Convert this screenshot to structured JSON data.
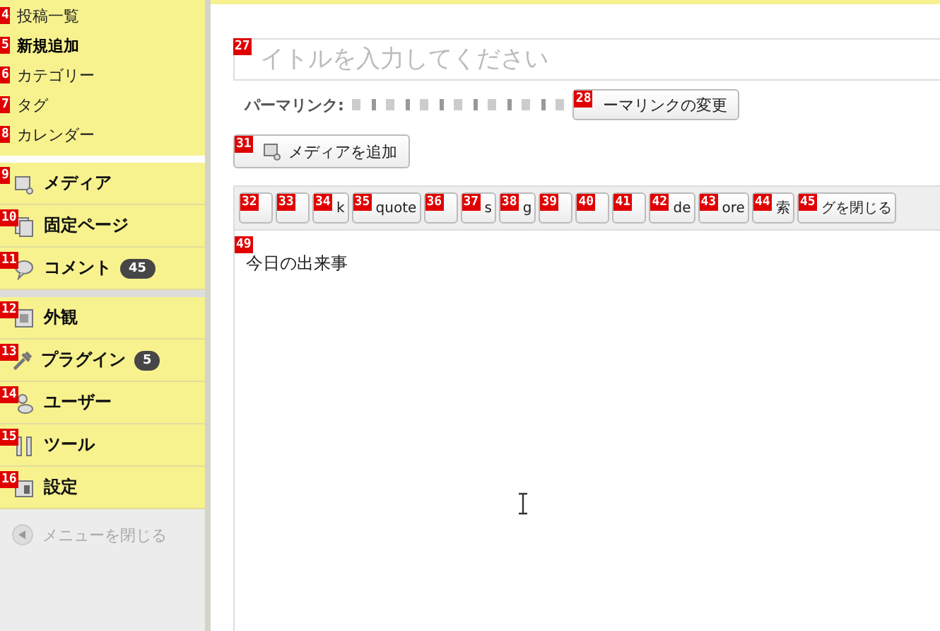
{
  "submenu": [
    {
      "label": "投稿一覧",
      "marker": "4",
      "selected": false
    },
    {
      "label": "新規追加",
      "marker": "5",
      "selected": true
    },
    {
      "label": "カテゴリー",
      "marker": "6",
      "selected": false
    },
    {
      "label": "タグ",
      "marker": "7",
      "selected": false
    },
    {
      "label": "カレンダー",
      "marker": "8",
      "selected": false
    }
  ],
  "menu": [
    {
      "label": "メディア",
      "marker": "9"
    },
    {
      "label": "固定ページ",
      "marker": "10"
    },
    {
      "label": "コメント",
      "marker": "11",
      "count": "45"
    },
    {
      "label": "外観",
      "marker": "12"
    },
    {
      "label": "プラグイン",
      "marker": "13",
      "count": "5"
    },
    {
      "label": "ユーザー",
      "marker": "14"
    },
    {
      "label": "ツール",
      "marker": "15"
    },
    {
      "label": "設定",
      "marker": "16"
    }
  ],
  "collapse": {
    "label": "メニューを閉じる"
  },
  "title_field": {
    "placeholder": "イトルを入力してください",
    "marker": "27"
  },
  "permalink": {
    "label": "パーマリンク:",
    "button": "ーマリンクの変更",
    "marker": "28"
  },
  "add_media": {
    "label": "メディアを追加",
    "marker": "31"
  },
  "quicktags": [
    {
      "marker": "32"
    },
    {
      "marker": "33"
    },
    {
      "marker": "34",
      "label": "k"
    },
    {
      "marker": "35",
      "label": "quote"
    },
    {
      "marker": "36"
    },
    {
      "marker": "37",
      "label": "s"
    },
    {
      "marker": "38",
      "label": "g"
    },
    {
      "marker": "39"
    },
    {
      "marker": "40"
    },
    {
      "marker": "41"
    },
    {
      "marker": "42",
      "label": "de"
    },
    {
      "marker": "43",
      "label": "ore"
    },
    {
      "marker": "44",
      "label": "索"
    },
    {
      "marker": "45",
      "label": "グを閉じる"
    }
  ],
  "editor": {
    "text": "今日の出来事",
    "marker": "49"
  }
}
